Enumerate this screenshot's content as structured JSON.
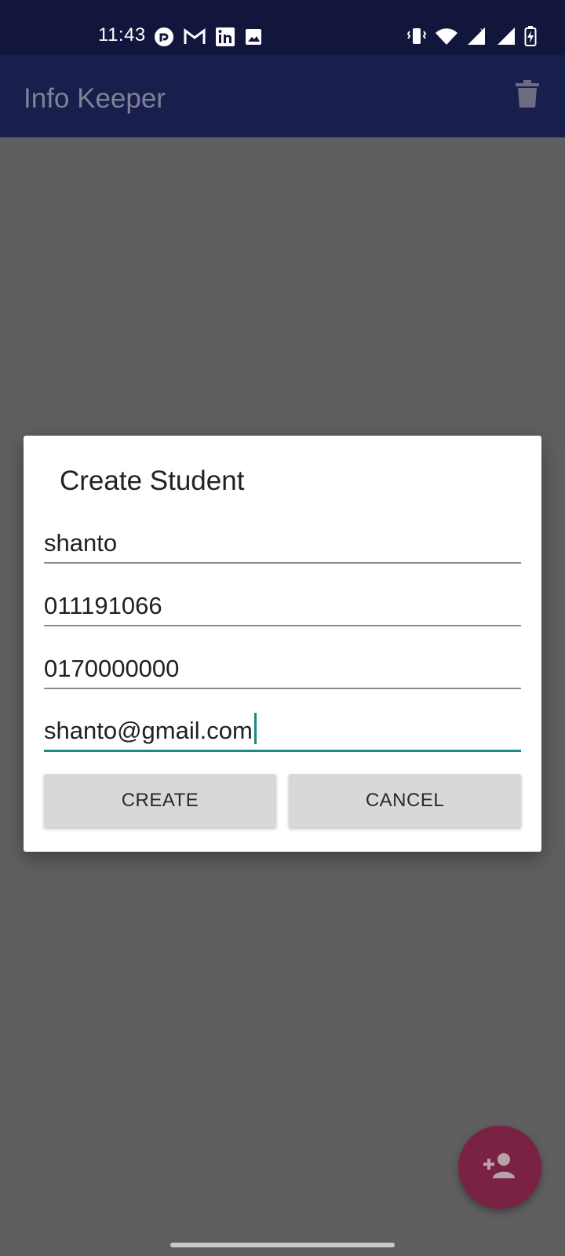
{
  "status_bar": {
    "time": "11:43",
    "left_icons": [
      "reddit-icon",
      "gmail-icon",
      "linkedin-icon",
      "gallery-icon"
    ],
    "right_icons": [
      "vibrate-icon",
      "wifi-icon",
      "signal-icon",
      "signal-icon-2",
      "battery-charging-icon"
    ]
  },
  "app_bar": {
    "title": "Info Keeper",
    "action_icon": "trash-icon"
  },
  "dialog": {
    "title": "Create Student",
    "fields": [
      {
        "value": "shanto"
      },
      {
        "value": "011191066"
      },
      {
        "value": "0170000000"
      },
      {
        "value": "shanto@gmail.com"
      }
    ],
    "create_label": "CREATE",
    "cancel_label": "CANCEL"
  },
  "fab": {
    "icon": "add-person-icon"
  },
  "colors": {
    "status_bar": "#12163d",
    "app_bar": "#191f4c",
    "scrim_background": "#5f5f5f",
    "accent": "#1c8a84",
    "fab": "#7a2243",
    "button": "#d7d8d8"
  }
}
